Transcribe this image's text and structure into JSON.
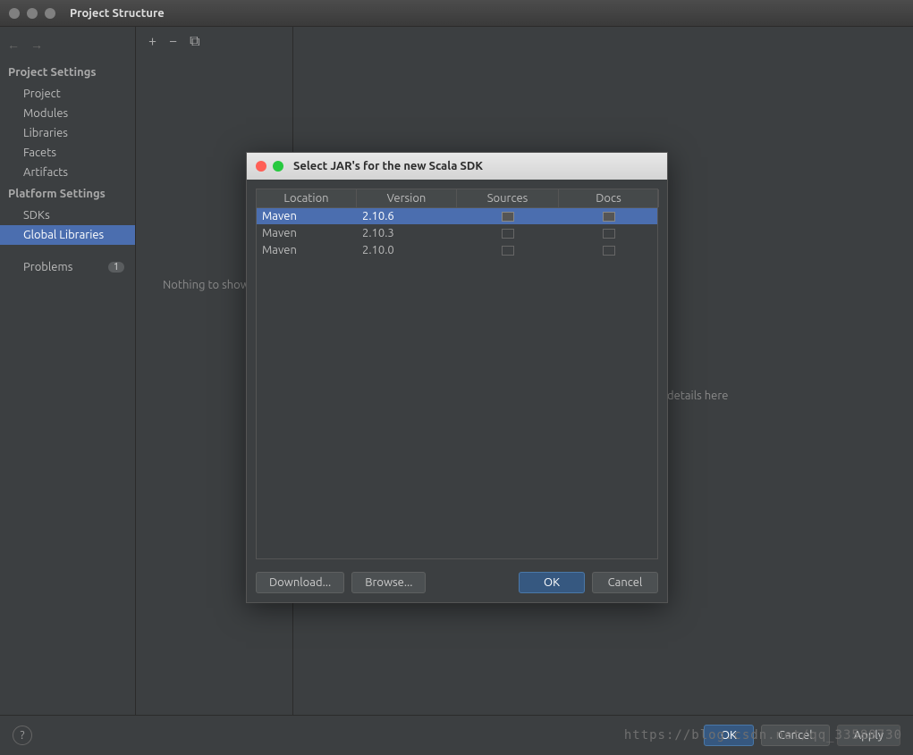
{
  "window": {
    "title": "Project Structure"
  },
  "sidebar": {
    "section1": "Project Settings",
    "items1": [
      "Project",
      "Modules",
      "Libraries",
      "Facets",
      "Artifacts"
    ],
    "section2": "Platform Settings",
    "items2": [
      "SDKs",
      "Global Libraries"
    ],
    "problems_label": "Problems",
    "problems_count": "1"
  },
  "middle": {
    "empty_text": "Nothing to show"
  },
  "detail": {
    "hint": "details here"
  },
  "footer": {
    "ok": "OK",
    "cancel": "Cancel",
    "apply": "Apply"
  },
  "watermark": "https://blog.csdn.net/qq_33588730",
  "dialog": {
    "title": "Select JAR's for the new Scala SDK",
    "columns": [
      "Location",
      "Version",
      "Sources",
      "Docs"
    ],
    "rows": [
      {
        "location": "Maven",
        "version": "2.10.6",
        "selected": true
      },
      {
        "location": "Maven",
        "version": "2.10.3",
        "selected": false
      },
      {
        "location": "Maven",
        "version": "2.10.0",
        "selected": false
      }
    ],
    "buttons": {
      "download": "Download...",
      "browse": "Browse...",
      "ok": "OK",
      "cancel": "Cancel"
    }
  }
}
